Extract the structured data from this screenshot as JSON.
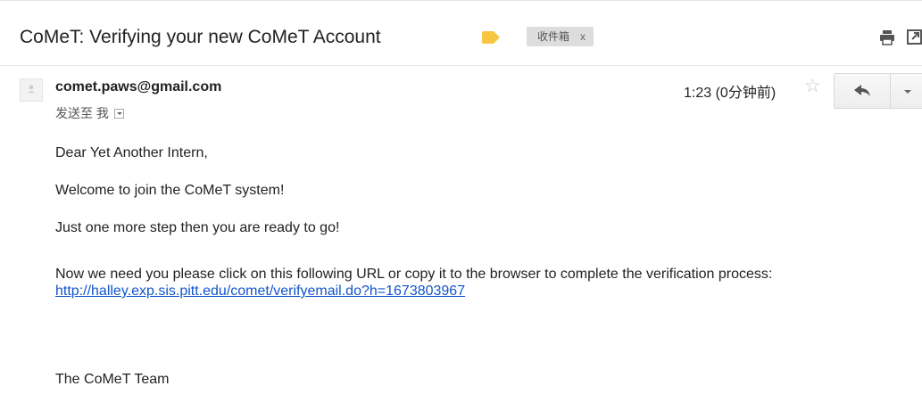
{
  "email": {
    "subject": "CoMeT: Verifying your new CoMeT Account",
    "label_chip": "收件箱",
    "label_chip_remove": "x",
    "label_color": "#f6c542",
    "sender": "comet.paws@gmail.com",
    "to_line": "发送至 我",
    "timestamp": "1:23 (0分钟前)",
    "star_glyph": "☆",
    "body": {
      "greeting": "Dear Yet Another Intern,",
      "line1": "Welcome to join the CoMeT system!",
      "line2": "Just one more step then you are ready to go!",
      "line3": "Now we need you please click on this following URL or copy it to the browser to complete the verification process:",
      "link": "http://halley.exp.sis.pitt.edu/comet/verifyemail.do?h=1673803967",
      "signature": "The CoMeT Team"
    }
  },
  "icons": {
    "print": "print-icon",
    "new_window": "open-in-new-window-icon",
    "reply": "reply-icon",
    "more": "dropdown-arrow-icon",
    "avatar": "person-icon",
    "label": "label-tag-icon"
  },
  "colors": {
    "link": "#1155cc",
    "chip_bg": "#dddddd",
    "star": "#c6c6c6"
  }
}
